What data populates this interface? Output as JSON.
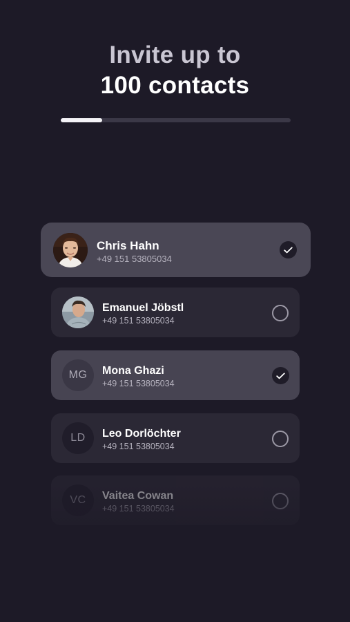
{
  "header": {
    "title_line1": "Invite up to",
    "title_line2": "100 contacts"
  },
  "progress": {
    "fraction": 0.18
  },
  "contacts": [
    {
      "name": "Chris Hahn",
      "phone": "+49 151 53805034",
      "avatar_type": "photo",
      "initials": "",
      "selected": true
    },
    {
      "name": "Emanuel Jöbstl",
      "phone": "+49 151 53805034",
      "avatar_type": "photo",
      "initials": "",
      "selected": false
    },
    {
      "name": "Mona Ghazi",
      "phone": "+49 151 53805034",
      "avatar_type": "initials",
      "initials": "MG",
      "selected": true
    },
    {
      "name": "Leo Dorlöchter",
      "phone": "+49 151 53805034",
      "avatar_type": "initials",
      "initials": "LD",
      "selected": false
    },
    {
      "name": "Vaitea Cowan",
      "phone": "+49 151 53805034",
      "avatar_type": "initials",
      "initials": "VC",
      "selected": false
    }
  ],
  "icons": {
    "selected": "checkmark-icon",
    "unselected": "empty-circle-icon"
  },
  "colors": {
    "background": "#1d1a27",
    "card": "#2b2835",
    "card_selected": "#474452",
    "progress_fill": "#f4f3f7",
    "progress_track": "#3b3847"
  }
}
